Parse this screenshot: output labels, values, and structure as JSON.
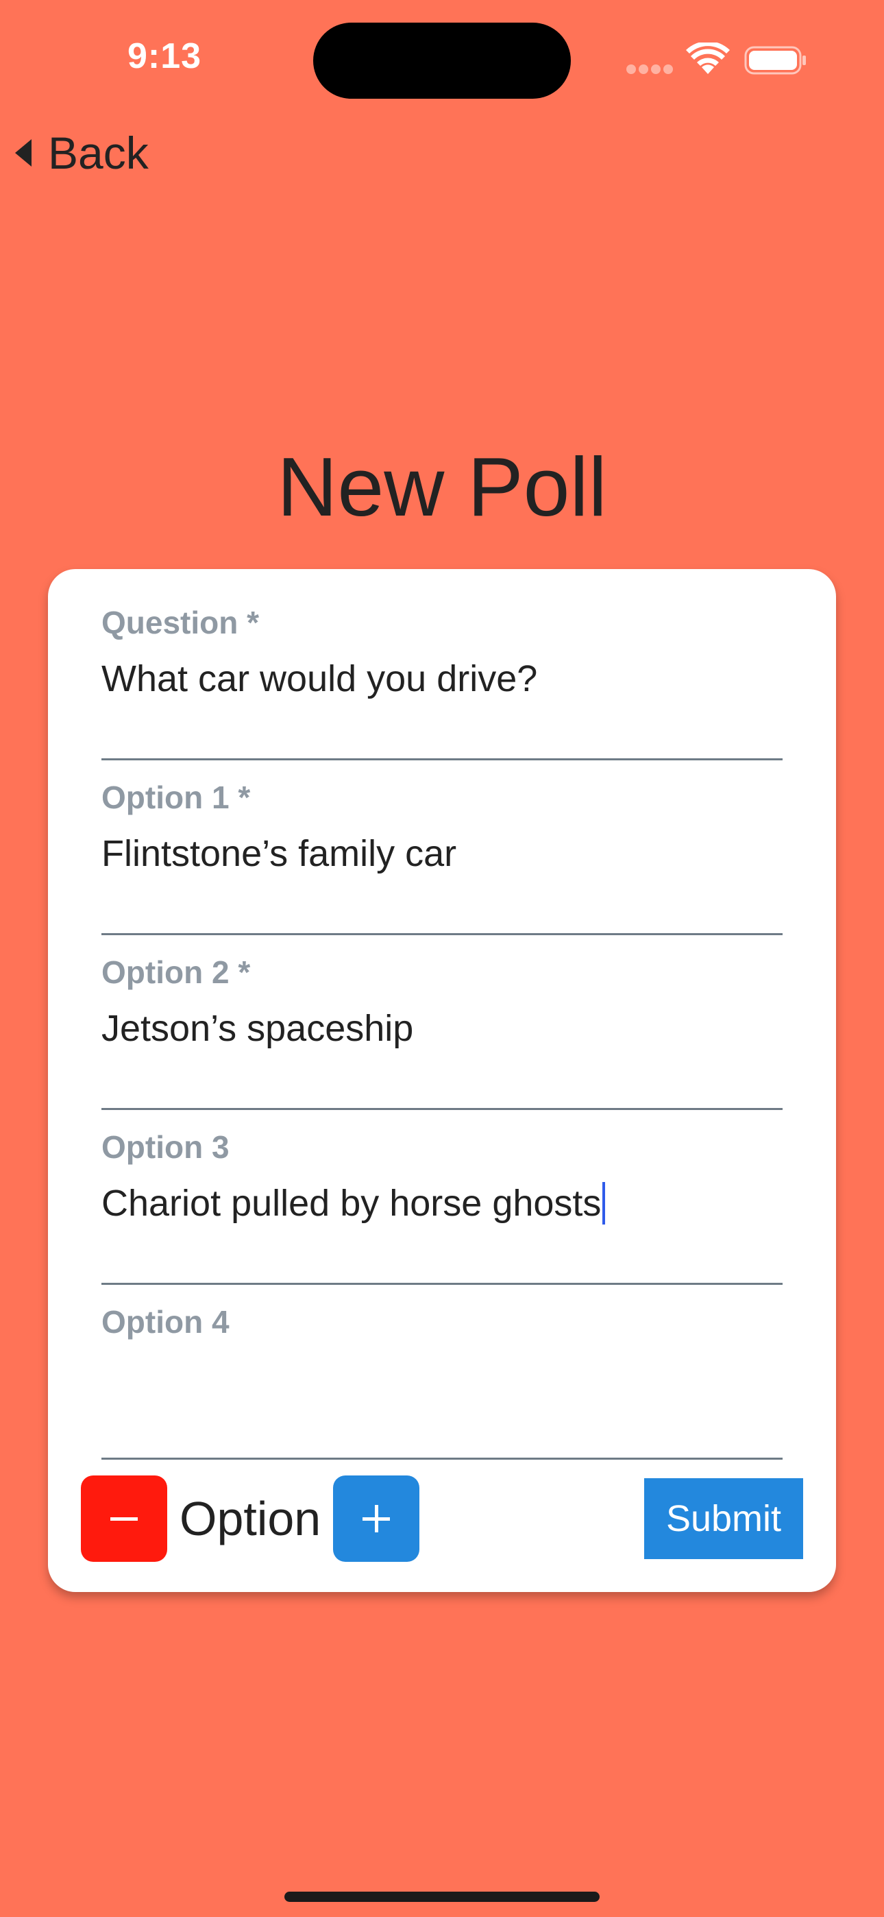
{
  "status_bar": {
    "time": "9:13",
    "wifi_icon": "wifi-icon",
    "battery_icon": "battery-icon"
  },
  "nav": {
    "back_label": "Back",
    "back_icon": "chevron-left-icon"
  },
  "page": {
    "title": "New Poll"
  },
  "form": {
    "fields": [
      {
        "label": "Question *",
        "value": "What car would you drive?"
      },
      {
        "label": "Option 1 *",
        "value": "Flintstone’s family car"
      },
      {
        "label": "Option 2 *",
        "value": "Jetson’s spaceship"
      },
      {
        "label": "Option 3",
        "value": "Chariot pulled by horse ghosts"
      },
      {
        "label": "Option 4",
        "value": ""
      }
    ],
    "focused_field_index": 3
  },
  "controls": {
    "option_label": "Option",
    "remove_icon": "minus-icon",
    "add_icon": "plus-icon",
    "submit_label": "Submit"
  },
  "colors": {
    "background": "#FF7357",
    "remove_button": "#FF1A0D",
    "add_button": "#2388DD",
    "submit_button": "#2388DD",
    "label_gray": "#8F99A3",
    "caret": "#2F5BEA"
  }
}
